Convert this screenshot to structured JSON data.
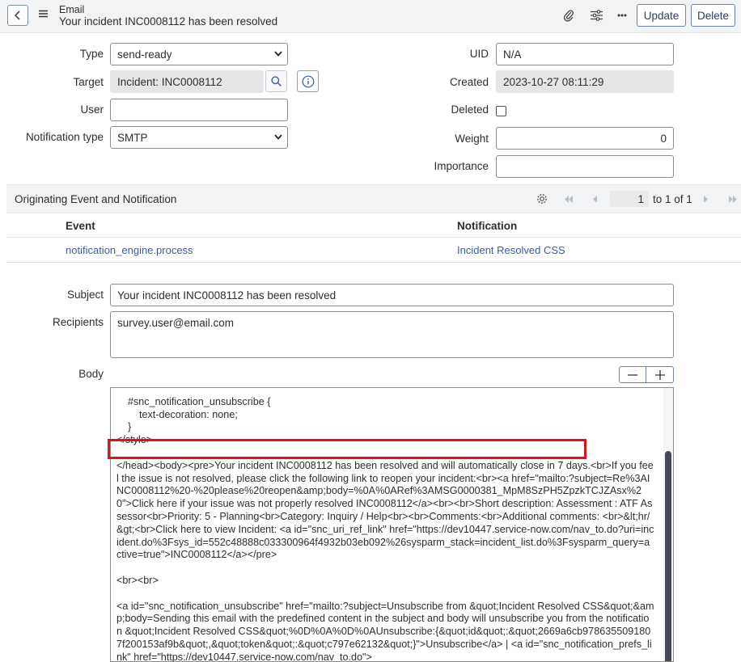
{
  "header": {
    "kind": "Email",
    "title": "Your incident INC0008112 has been resolved",
    "update_label": "Update",
    "delete_label": "Delete"
  },
  "form": {
    "type": {
      "label": "Type",
      "value": "send-ready"
    },
    "target": {
      "label": "Target",
      "value": "Incident: INC0008112"
    },
    "user": {
      "label": "User",
      "value": ""
    },
    "notification_type": {
      "label": "Notification type",
      "value": "SMTP"
    },
    "uid": {
      "label": "UID",
      "value": "N/A"
    },
    "created": {
      "label": "Created",
      "value": "2023-10-27 08:11:29"
    },
    "deleted": {
      "label": "Deleted",
      "checked": false
    },
    "weight": {
      "label": "Weight",
      "value": "0"
    },
    "importance": {
      "label": "Importance",
      "value": ""
    },
    "subject": {
      "label": "Subject",
      "value": "Your incident INC0008112 has been resolved"
    },
    "recipients": {
      "label": "Recipients",
      "value": "survey.user@email.com"
    },
    "body": {
      "label": "Body"
    }
  },
  "related_list": {
    "title": "Originating Event and Notification",
    "page_input": "1",
    "page_text": "to 1 of 1",
    "columns": [
      "Event",
      "Notification"
    ],
    "rows": [
      {
        "event": "notification_engine.process",
        "notification": "Incident Resolved CSS"
      }
    ]
  },
  "body_lines": [
    "    #snc_notification_unsubscribe {",
    "        text-decoration: none;",
    "    }",
    "</style>",
    "",
    "</head><body><pre>Your incident INC0008112 has been resolved and will automatically close in 7 days.<br>If you feel the issue is not resolved, please click the following link to reopen your incident:<br><a href=\"mailto:?subject=Re%3AINC0008112%20-%20please%20reopen&amp;body=%0A%0ARef%3AMSG0000381_MpM8SzPH5ZpzkTCJZAsx%20\">Click here if your issue was not properly resolved INC0008112</a><br><br>Short description: Assessment : ATF Assessor<br>Priority: 5 - Planning<br>Category: Inquiry / Help<br><br>Comments:<br>Additional comments: <br>&lt;hr/&gt;<br>Click here to view Incident: <a id=\"snc_uri_ref_link\" href=\"https://dev10447.service-now.com/nav_to.do?uri=incident.do%3Fsys_id=552c48888c033300964f4932b03eb092%26sysparm_stack=incident_list.do%3Fsysparm_query=active=true\">INC0008112</a></pre>",
    "",
    "<br><br>",
    "",
    "<a id=\"snc_notification_unsubscribe\" href=\"mailto:?subject=Unsubscribe from &quot;Incident Resolved CSS&quot;&amp;body=Sending this email with the predefined content in the subject and body will unsubscribe you from the notification &quot;Incident Resolved CSS&quot;%0D%0A%0D%0AUnsubscribe:{&quot;id&quot;:&quot;2669a6cb9786355091807f200153af9b&quot;,&quot;token&quot;:&quot;c797e62132&quot;}\">Unsubscribe</a> | <a id=\"snc_notification_prefs_link\" href=\"https://dev10447.service-now.com/nav_to.do\">"
  ],
  "colors": {
    "link": "#3b5bad",
    "highlight": "#e0111d",
    "button_text": "#293e6a"
  }
}
